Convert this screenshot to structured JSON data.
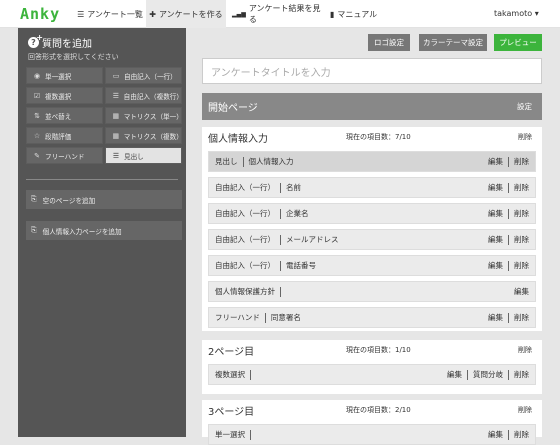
{
  "header": {
    "logo": "Anky",
    "nav": [
      {
        "icon": "list-icon",
        "glyph": "☰",
        "label": "アンケート一覧"
      },
      {
        "icon": "plus-icon",
        "glyph": "✚",
        "label": "アンケートを作る"
      },
      {
        "icon": "bar-chart-icon",
        "glyph": "▮",
        "label": "アンケート結果を見る"
      },
      {
        "icon": "document-icon",
        "glyph": "▮",
        "label": "マニュアル"
      }
    ],
    "user": "takamoto ▾"
  },
  "sidebar": {
    "title": "質問を追加",
    "subtitle": "回答形式を選択してください",
    "types": [
      {
        "icon": "radio-icon",
        "glyph": "◉",
        "label": "単一選択"
      },
      {
        "icon": "single-line-icon",
        "glyph": "▭",
        "label": "自由記入（一行）"
      },
      {
        "icon": "checkbox-icon",
        "glyph": "☑",
        "label": "複数選択"
      },
      {
        "icon": "multi-line-icon",
        "glyph": "☰",
        "label": "自由記入（複数行）"
      },
      {
        "icon": "sort-icon",
        "glyph": "⇅",
        "label": "並べ替え"
      },
      {
        "icon": "matrix-single-icon",
        "glyph": "▦",
        "label": "マトリクス（単一）"
      },
      {
        "icon": "star-icon",
        "glyph": "☆",
        "label": "段階評価"
      },
      {
        "icon": "matrix-multi-icon",
        "glyph": "▦",
        "label": "マトリクス（複数）"
      },
      {
        "icon": "freehand-icon",
        "glyph": "✎",
        "label": "フリーハンド"
      },
      {
        "icon": "heading-icon",
        "glyph": "☰",
        "label": "見出し"
      }
    ],
    "add_blank_page": "空のページを追加",
    "add_personal_page": "個人情報入力ページを追加"
  },
  "toolbar": {
    "logo_settings": "ロゴ設定",
    "color_theme": "カラーテーマ設定",
    "preview": "プレビュー"
  },
  "colors": {
    "accent": "#3cb43c",
    "sidebar": "#555555"
  },
  "survey": {
    "title_placeholder": "アンケートタイトルを入力",
    "start_page": "開始ページ",
    "start_settings": "設定",
    "sections": [
      {
        "title": "個人情報入力",
        "count": "現在の項目数：7/10",
        "delete": "削除",
        "rows": [
          {
            "type": "見出し",
            "label": "個人情報入力",
            "actions": [
              "編集",
              "削除"
            ]
          },
          {
            "type": "自由記入（一行）",
            "label": "名前",
            "actions": [
              "編集",
              "削除"
            ]
          },
          {
            "type": "自由記入（一行）",
            "label": "企業名",
            "actions": [
              "編集",
              "削除"
            ]
          },
          {
            "type": "自由記入（一行）",
            "label": "メールアドレス",
            "actions": [
              "編集",
              "削除"
            ]
          },
          {
            "type": "自由記入（一行）",
            "label": "電話番号",
            "actions": [
              "編集",
              "削除"
            ]
          },
          {
            "type": "個人情報保護方針",
            "label": "",
            "actions": [
              "編集"
            ]
          },
          {
            "type": "フリーハンド",
            "label": "同意署名",
            "actions": [
              "編集",
              "削除"
            ]
          }
        ]
      },
      {
        "title": "2ページ目",
        "count": "現在の項目数：1/10",
        "delete": "削除",
        "rows": [
          {
            "type": "複数選択",
            "label": "",
            "actions": [
              "編集",
              "質問分岐",
              "削除"
            ]
          }
        ]
      },
      {
        "title": "3ページ目",
        "count": "現在の項目数：2/10",
        "delete": "削除",
        "rows": [
          {
            "type": "単一選択",
            "label": "",
            "actions": [
              "編集",
              "削除"
            ]
          }
        ]
      }
    ]
  }
}
